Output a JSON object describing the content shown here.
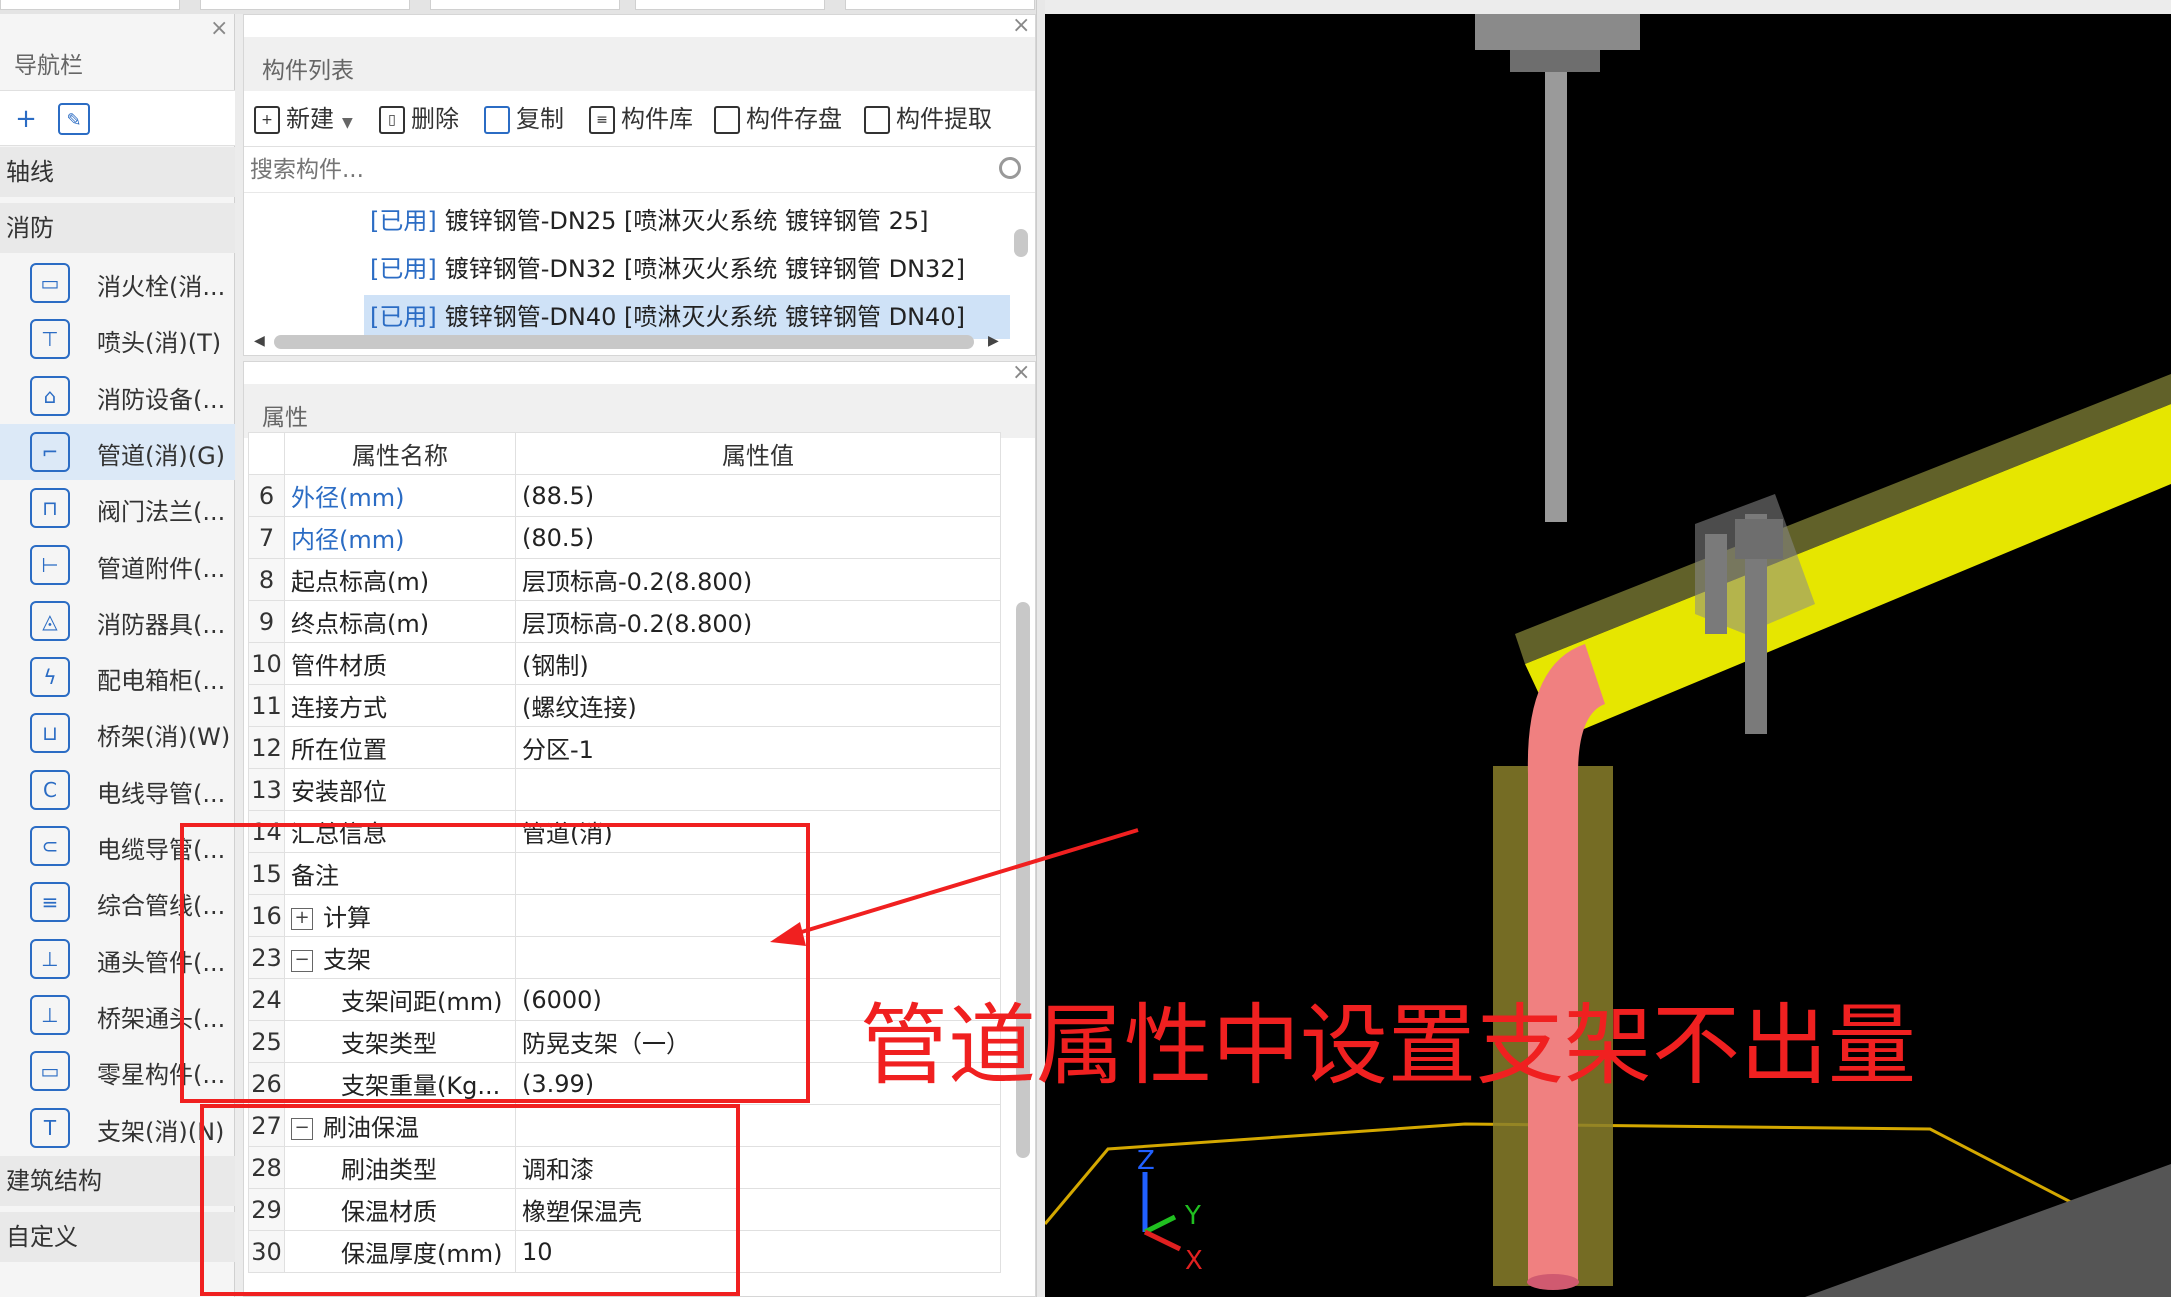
{
  "nav": {
    "title": "导航栏",
    "sections": {
      "axis": "轴线",
      "fire": "消防",
      "building": "建筑结构",
      "custom": "自定义"
    },
    "items": [
      {
        "label": "消火栓(消...",
        "icon": "hydrant-icon"
      },
      {
        "label": "喷头(消)(T)",
        "icon": "sprinkler-icon"
      },
      {
        "label": "消防设备(...",
        "icon": "fire-equipment-icon"
      },
      {
        "label": "管道(消)(G)",
        "icon": "pipe-icon",
        "selected": true
      },
      {
        "label": "阀门法兰(...",
        "icon": "valve-icon"
      },
      {
        "label": "管道附件(...",
        "icon": "pipe-fitting-icon"
      },
      {
        "label": "消防器具(...",
        "icon": "alarm-icon"
      },
      {
        "label": "配电箱柜(...",
        "icon": "distribution-box-icon"
      },
      {
        "label": "桥架(消)(W)",
        "icon": "cable-tray-icon"
      },
      {
        "label": "电线导管(...",
        "icon": "wire-conduit-icon"
      },
      {
        "label": "电缆导管(...",
        "icon": "cable-conduit-icon"
      },
      {
        "label": "综合管线(...",
        "icon": "combined-pipeline-icon"
      },
      {
        "label": "通头管件(...",
        "icon": "tee-fitting-icon"
      },
      {
        "label": "桥架通头(...",
        "icon": "tray-tee-icon"
      },
      {
        "label": "零星构件(...",
        "icon": "misc-component-icon"
      },
      {
        "label": "支架(消)(N)",
        "icon": "bracket-icon"
      }
    ]
  },
  "components": {
    "title": "构件列表",
    "toolbar": {
      "new": "新建",
      "delete": "删除",
      "copy": "复制",
      "library": "构件库",
      "save": "构件存盘",
      "extract": "构件提取"
    },
    "search_placeholder": "搜索构件...",
    "rows": [
      {
        "tag": "[已用]",
        "text": "镀锌钢管-DN25 [喷淋灭火系统 镀锌钢管 25]"
      },
      {
        "tag": "[已用]",
        "text": "镀锌钢管-DN32 [喷淋灭火系统 镀锌钢管 DN32]"
      },
      {
        "tag": "[已用]",
        "text": "镀锌钢管-DN40 [喷淋灭火系统 镀锌钢管 DN40]",
        "selected": true
      }
    ]
  },
  "properties": {
    "title": "属性",
    "col_name": "属性名称",
    "col_value": "属性值",
    "rows": [
      {
        "n": "6",
        "name": "外径(mm)",
        "value": "(88.5)",
        "blue": true
      },
      {
        "n": "7",
        "name": "内径(mm)",
        "value": "(80.5)",
        "blue": true
      },
      {
        "n": "8",
        "name": "起点标高(m)",
        "value": "层顶标高-0.2(8.800)"
      },
      {
        "n": "9",
        "name": "终点标高(m)",
        "value": "层顶标高-0.2(8.800)"
      },
      {
        "n": "10",
        "name": "管件材质",
        "value": "(钢制)"
      },
      {
        "n": "11",
        "name": "连接方式",
        "value": "(螺纹连接)"
      },
      {
        "n": "12",
        "name": "所在位置",
        "value": "分区-1"
      },
      {
        "n": "13",
        "name": "安装部位",
        "value": ""
      },
      {
        "n": "14",
        "name": "汇总信息",
        "value": "管道(消)"
      },
      {
        "n": "15",
        "name": "备注",
        "value": ""
      },
      {
        "n": "16",
        "name": "计算",
        "value": "",
        "toggle": "+"
      },
      {
        "n": "23",
        "name": "支架",
        "value": "",
        "toggle": "−"
      },
      {
        "n": "24",
        "name": "支架间距(mm)",
        "value": "(6000)",
        "child": true
      },
      {
        "n": "25",
        "name": "支架类型",
        "value": "防晃支架（一）",
        "child": true
      },
      {
        "n": "26",
        "name": "支架重量(Kg...",
        "value": "(3.99)",
        "child": true
      },
      {
        "n": "27",
        "name": "刷油保温",
        "value": "",
        "toggle": "−"
      },
      {
        "n": "28",
        "name": "刷油类型",
        "value": "调和漆",
        "child": true
      },
      {
        "n": "29",
        "name": "保温材质",
        "value": "橡塑保温壳",
        "child": true
      },
      {
        "n": "30",
        "name": "保温厚度(mm)",
        "value": "10",
        "child": true
      }
    ]
  },
  "annotation": {
    "text": "管道属性中设置支架不出量",
    "color": "#f02020"
  },
  "view3d": {
    "axis_x": "X",
    "axis_y": "Y",
    "axis_z": "Z"
  },
  "colors": {
    "accent": "#2b6cc4",
    "pipe": "#e6e600",
    "elbow": "#f08080",
    "annotation": "#f02020"
  }
}
